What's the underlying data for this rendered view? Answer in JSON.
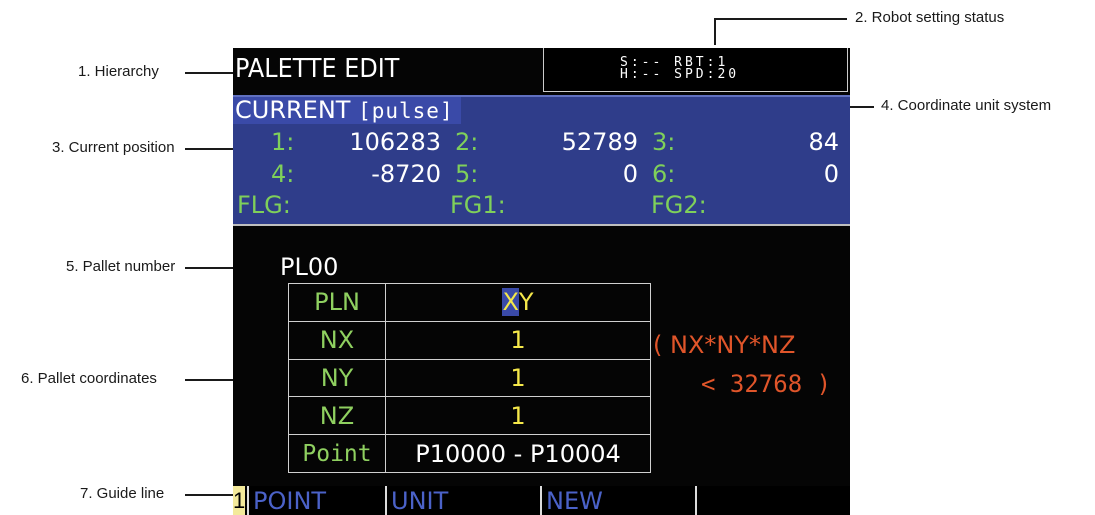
{
  "annotations": {
    "hierarchy": "1. Hierarchy",
    "robot_setting_status": "2. Robot setting status",
    "current_position": "3. Current position",
    "coordinate_unit_system": "4. Coordinate unit system",
    "pallet_number": "5. Pallet number",
    "pallet_coordinates": "6. Pallet coordinates",
    "guide_line": "7. Guide line"
  },
  "screen": {
    "hierarchy": "PALETTE EDIT",
    "status_line1": "S:-- RBT:1",
    "status_line2": "H:-- SPD:20",
    "current": {
      "title": "CURRENT",
      "unit": "[pulse]",
      "axes": [
        {
          "label": "1:",
          "value": "106283"
        },
        {
          "label": "2:",
          "value": "52789"
        },
        {
          "label": "3:",
          "value": "84"
        },
        {
          "label": "4:",
          "value": "-8720"
        },
        {
          "label": "5:",
          "value": "0"
        },
        {
          "label": "6:",
          "value": "0"
        }
      ],
      "flags": [
        "FLG:",
        "FG1:",
        "FG2:"
      ]
    },
    "pallet_number": "PL00",
    "pallet_table": [
      {
        "key": "PLN",
        "value": "XY"
      },
      {
        "key": "NX",
        "value": "1"
      },
      {
        "key": "NY",
        "value": "1"
      },
      {
        "key": "NZ",
        "value": "1"
      },
      {
        "key": "Point",
        "value": "P10000 - P10004"
      }
    ],
    "note_line1": "( NX*NY*NZ",
    "note_line2": "< 32768 )",
    "guide": {
      "page": "1",
      "keys": [
        "POINT",
        "UNIT",
        "NEW",
        ""
      ]
    }
  }
}
